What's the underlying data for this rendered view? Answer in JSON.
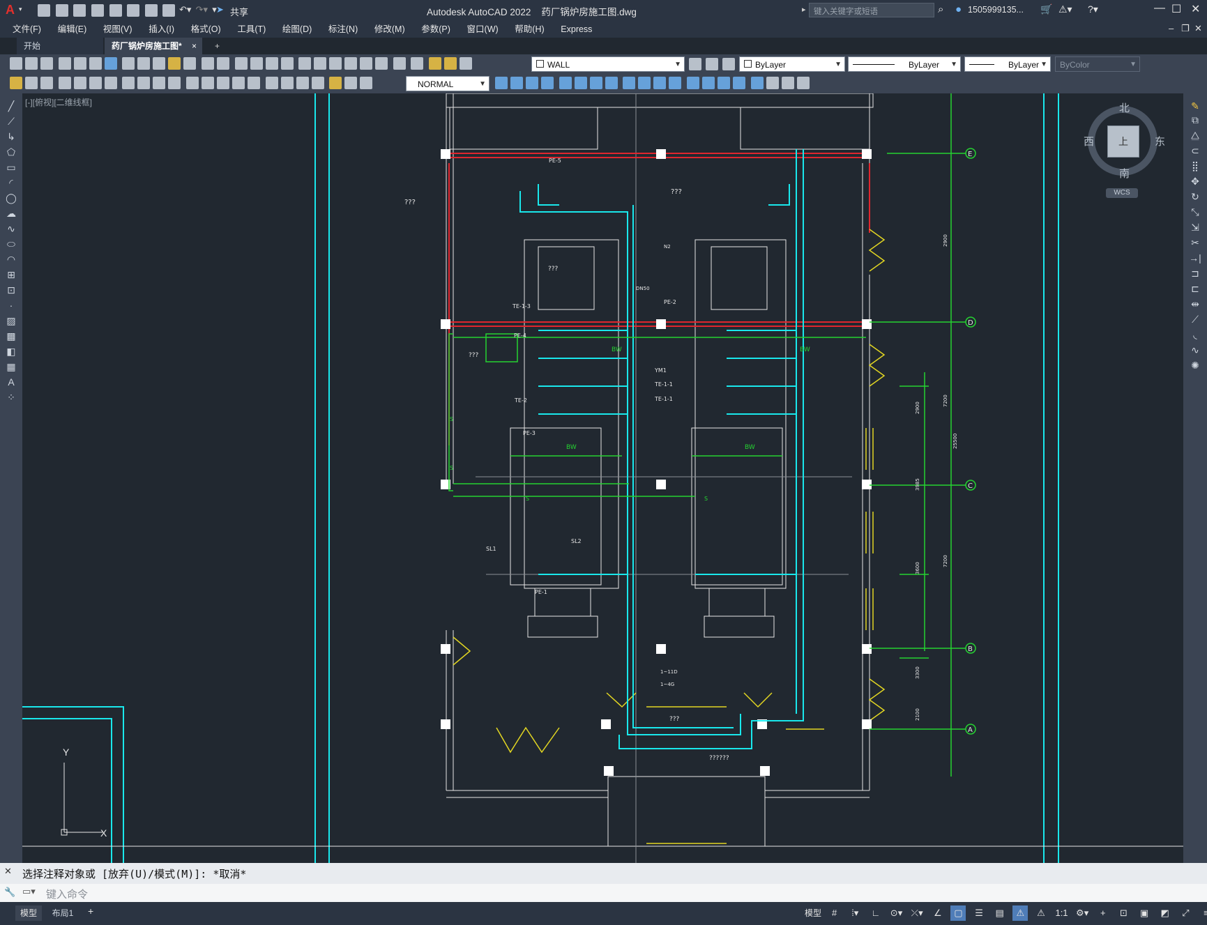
{
  "app": {
    "logo": "A",
    "title": "Autodesk AutoCAD 2022    药厂锅炉房施工图.dwg",
    "share_label": "共享",
    "search_placeholder": "键入关键字或短语",
    "user": "1505999135...",
    "icons": [
      "new-icon",
      "open-icon",
      "save-icon",
      "saveas-icon",
      "print-icon",
      "undo-icon",
      "redo-icon",
      "share-icon",
      "search-icon",
      "user-icon",
      "cart-icon",
      "help-icon",
      "minimize-icon",
      "maximize-icon",
      "close-icon"
    ]
  },
  "menu": {
    "items": [
      "文件(F)",
      "编辑(E)",
      "视图(V)",
      "插入(I)",
      "格式(O)",
      "工具(T)",
      "绘图(D)",
      "标注(N)",
      "修改(M)",
      "参数(P)",
      "窗口(W)",
      "帮助(H)",
      "Express"
    ]
  },
  "tabs": {
    "start": "开始",
    "active": "药厂锅炉房施工图*",
    "close": "×",
    "add": "+"
  },
  "toolbar": {
    "layer": "WALL",
    "color": "ByLayer",
    "linetype": "ByLayer",
    "lineweight": "ByLayer",
    "plotstyle": "ByColor",
    "dimstyle": "NORMAL"
  },
  "viewport": {
    "label": "[-][俯视][二维线框]",
    "compass": {
      "north": "北",
      "south": "南",
      "east": "东",
      "west": "西",
      "top": "上",
      "wcs": "WCS"
    },
    "ucs": {
      "x": "X",
      "y": "Y"
    }
  },
  "drawing": {
    "grid_labels": [
      "E",
      "D",
      "C",
      "B",
      "A"
    ],
    "annotations": [
      "???",
      "???",
      "PE-5",
      "PE-2",
      "TE-1-3",
      "PE-4",
      "TE-2",
      "PE-3",
      "TE-1-1",
      "TE-1-1",
      "YM1",
      "SL1",
      "SL2",
      "PE-1",
      "BW",
      "BW",
      "BW",
      "BW",
      "S",
      "S",
      "S",
      "S",
      "???",
      "???",
      "1~11D",
      "1~4G",
      "??????",
      "???",
      "DN50",
      "N2"
    ],
    "dims": [
      "2100",
      "3300",
      "7200",
      "7200",
      "3985",
      "3600",
      "2900",
      "2900",
      "25500"
    ],
    "colors": {
      "cyan": "#19e8ec",
      "green": "#25d331",
      "red": "#e0262e",
      "white": "#e6e6e6",
      "yellow": "#e2d622",
      "gray": "#8a8f96"
    }
  },
  "command": {
    "history": "选择注释对象或 [放弃(U)/模式(M)]: *取消*",
    "prompt_placeholder": "键入命令"
  },
  "status": {
    "tabs": [
      "模型",
      "布局1"
    ],
    "add": "+",
    "model_label": "模型",
    "scale": "1:1"
  }
}
